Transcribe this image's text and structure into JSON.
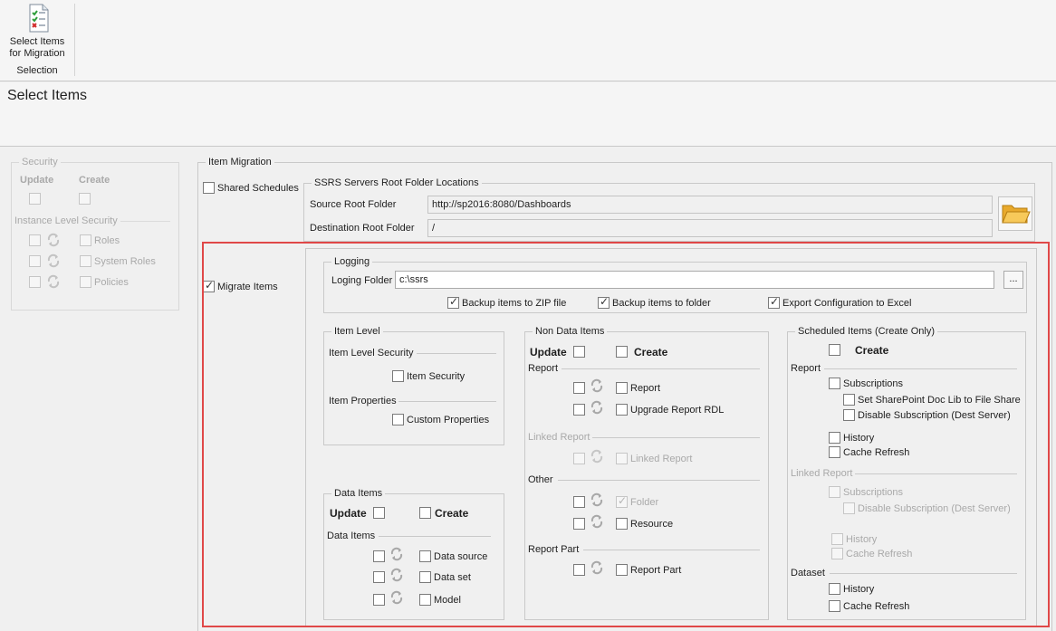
{
  "ribbon": {
    "select_items_label": "Select Items for Migration",
    "group_label": "Selection"
  },
  "header": {
    "title": "Select Items"
  },
  "security": {
    "title": "Security",
    "update": "Update",
    "create": "Create",
    "instance_level": "Instance Level Security",
    "roles": "Roles",
    "system_roles": "System Roles",
    "policies": "Policies"
  },
  "item_migration": {
    "title": "Item Migration",
    "shared_schedules": "Shared Schedules",
    "migrate_items": "Migrate Items",
    "servers": {
      "title": "SSRS Servers Root Folder Locations",
      "source_label": "Source Root Folder",
      "source_value": "http://sp2016:8080/Dashboards",
      "dest_label": "Destination Root Folder",
      "dest_value": "/"
    }
  },
  "logging": {
    "title": "Logging",
    "folder_label": "Loging Folder",
    "folder_value": "c:\\ssrs",
    "browse": "...",
    "zip": "Backup items to ZIP file",
    "folder": "Backup items to folder",
    "excel": "Export Configuration to Excel"
  },
  "item_level": {
    "title": "Item Level",
    "security_section": "Item Level Security",
    "item_security": "Item Security",
    "properties_section": "Item Properties",
    "custom_properties": "Custom Properties"
  },
  "data_items": {
    "title": "Data Items",
    "update": "Update",
    "create": "Create",
    "section": "Data Items",
    "data_source": "Data source",
    "data_set": "Data set",
    "model": "Model"
  },
  "non_data": {
    "title": "Non Data Items",
    "update": "Update",
    "create": "Create",
    "report_section": "Report",
    "report": "Report",
    "upgrade_rdl": "Upgrade Report RDL",
    "linked_section": "Linked Report",
    "linked_report": "Linked Report",
    "other_section": "Other",
    "folder": "Folder",
    "resource": "Resource",
    "part_section": "Report Part",
    "report_part": "Report Part"
  },
  "scheduled": {
    "title": "Scheduled Items (Create Only)",
    "create": "Create",
    "report_section": "Report",
    "subscriptions": "Subscriptions",
    "sharepoint": "Set SharePoint Doc Lib to File Share",
    "disable_sub": "Disable Subscription (Dest Server)",
    "history": "History",
    "cache_refresh": "Cache Refresh",
    "linked_section": "Linked Report",
    "dataset_section": "Dataset"
  }
}
